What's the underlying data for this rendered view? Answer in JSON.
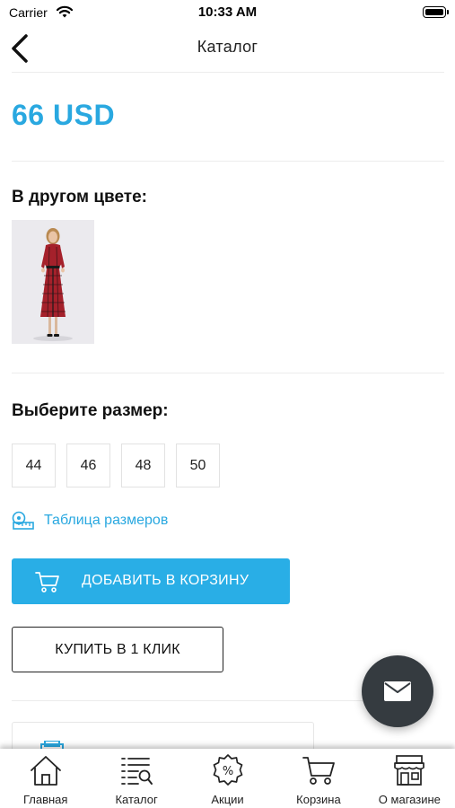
{
  "status_bar": {
    "carrier": "Carrier",
    "time": "10:33 AM"
  },
  "nav": {
    "title": "Каталог"
  },
  "product": {
    "price": "66 USD"
  },
  "other_colors": {
    "title": "В другом цвете:"
  },
  "sizes": {
    "title": "Выберите размер:",
    "options": [
      "44",
      "46",
      "48",
      "50"
    ]
  },
  "size_chart": {
    "label": "Таблица размеров"
  },
  "actions": {
    "add_to_cart": "ДОБАВИТЬ В КОРЗИНУ",
    "buy_one_click": "КУПИТЬ В 1 КЛИК"
  },
  "tab_bar": {
    "items": [
      {
        "label": "Главная",
        "icon": "home-icon"
      },
      {
        "label": "Каталог",
        "icon": "catalog-list-icon"
      },
      {
        "label": "Акции",
        "icon": "percent-badge-icon"
      },
      {
        "label": "Корзина",
        "icon": "cart-icon"
      },
      {
        "label": "О магазине",
        "icon": "store-icon"
      }
    ]
  },
  "colors": {
    "accent": "#29a8e0",
    "button_blue": "#29aee6",
    "fab": "#353b40",
    "dress_red": "#a5212b"
  }
}
